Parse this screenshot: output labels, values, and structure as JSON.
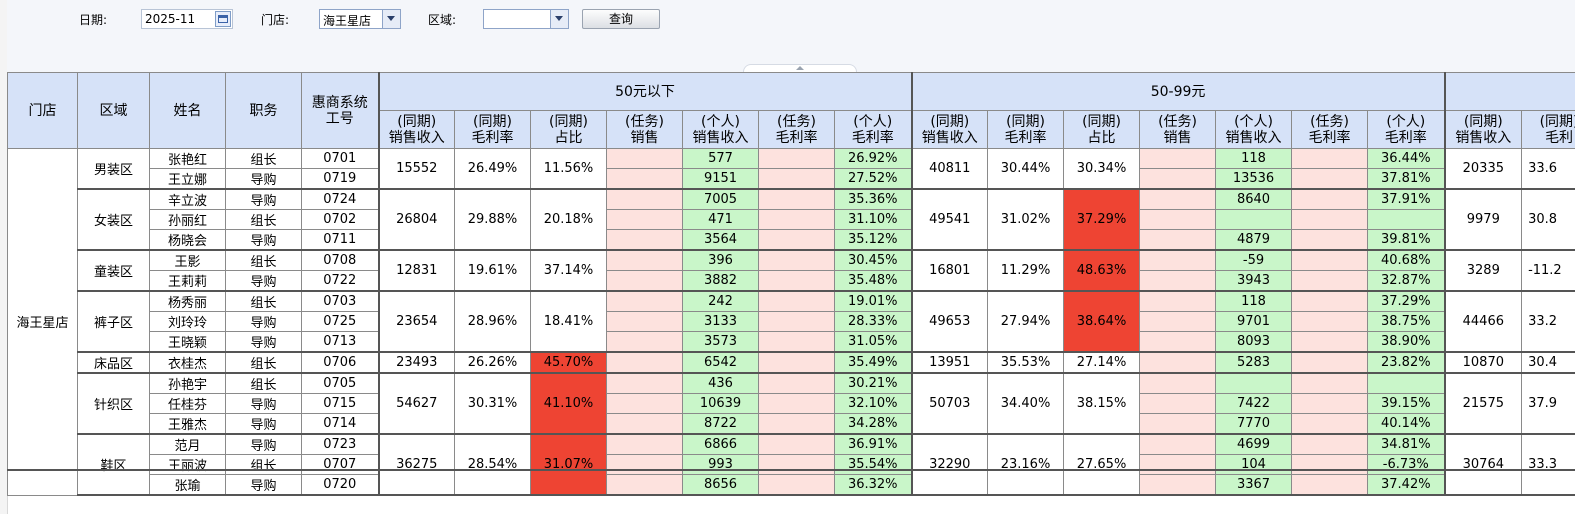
{
  "toolbar": {
    "date_label": "日期:",
    "date_value": "2025-11",
    "store_label": "门店:",
    "store_value": "海王星店",
    "region_label": "区域:",
    "region_value": "",
    "query_button": "查询"
  },
  "header": {
    "store": "门店",
    "region": "区域",
    "name": "姓名",
    "position": "职务",
    "employee_id_l1": "惠商系统",
    "employee_id_l2": "工号",
    "group1": "50元以下",
    "group2": "50-99元",
    "sub": [
      [
        "(同期)",
        "销售收入"
      ],
      [
        "(同期)",
        "毛利率"
      ],
      [
        "(同期)",
        "占比"
      ],
      [
        "(任务)",
        "销售"
      ],
      [
        "(个人)",
        "销售收入"
      ],
      [
        "(任务)",
        "毛利率"
      ],
      [
        "(个人)",
        "毛利率"
      ]
    ],
    "extra": [
      [
        "(同期)",
        "销售收入"
      ],
      [
        "(同期)",
        "毛利"
      ]
    ]
  },
  "store_name": "海王星店",
  "groups": [
    {
      "region": "男装区",
      "g1": {
        "rev": "15552",
        "margin": "26.49%",
        "share": "11.56%"
      },
      "g2": {
        "rev": "40811",
        "margin": "30.44%",
        "share": "30.34%"
      },
      "g3": {
        "rev": "20335",
        "margin": "33.6"
      }
    },
    {
      "region": "女装区",
      "g1": {
        "rev": "26804",
        "margin": "29.88%",
        "share": "20.18%"
      },
      "g2": {
        "rev": "49541",
        "margin": "31.02%",
        "share": "37.29%"
      },
      "g3": {
        "rev": "9979",
        "margin": "30.8"
      }
    },
    {
      "region": "童装区",
      "g1": {
        "rev": "12831",
        "margin": "19.61%",
        "share": "37.14%"
      },
      "g2": {
        "rev": "16801",
        "margin": "11.29%",
        "share": "48.63%"
      },
      "g3": {
        "rev": "3289",
        "margin": "-11.2"
      }
    },
    {
      "region": "裤子区",
      "g1": {
        "rev": "23654",
        "margin": "28.96%",
        "share": "18.41%"
      },
      "g2": {
        "rev": "49653",
        "margin": "27.94%",
        "share": "38.64%"
      },
      "g3": {
        "rev": "44466",
        "margin": "33.2"
      }
    },
    {
      "region": "床品区",
      "g1": {
        "rev": "23493",
        "margin": "26.26%",
        "share": "45.70%"
      },
      "g2": {
        "rev": "13951",
        "margin": "35.53%",
        "share": "27.14%"
      },
      "g3": {
        "rev": "10870",
        "margin": "30.4"
      }
    },
    {
      "region": "针织区",
      "g1": {
        "rev": "54627",
        "margin": "30.31%",
        "share": "41.10%"
      },
      "g2": {
        "rev": "50703",
        "margin": "34.40%",
        "share": "38.15%"
      },
      "g3": {
        "rev": "21575",
        "margin": "37.9"
      }
    },
    {
      "region": "鞋区",
      "g1": {
        "rev": "36275",
        "margin": "28.54%",
        "share": "31.07%"
      },
      "g2": {
        "rev": "32290",
        "margin": "23.16%",
        "share": "27.65%"
      },
      "g3": {
        "rev": "30764",
        "margin": "33.3"
      }
    }
  ],
  "people": [
    {
      "name": "张艳红",
      "role": "组长",
      "id": "0701",
      "p1": "577",
      "pm1": "26.92%",
      "p2": "118",
      "pm2": "36.44%"
    },
    {
      "name": "王立娜",
      "role": "导购",
      "id": "0719",
      "p1": "9151",
      "pm1": "27.52%",
      "p2": "13536",
      "pm2": "37.81%"
    },
    {
      "name": "辛立波",
      "role": "导购",
      "id": "0724",
      "p1": "7005",
      "pm1": "35.36%",
      "p2": "8640",
      "pm2": "37.91%"
    },
    {
      "name": "孙丽红",
      "role": "组长",
      "id": "0702",
      "p1": "471",
      "pm1": "31.10%",
      "p2": "",
      "pm2": ""
    },
    {
      "name": "杨晓会",
      "role": "导购",
      "id": "0711",
      "p1": "3564",
      "pm1": "35.12%",
      "p2": "4879",
      "pm2": "39.81%"
    },
    {
      "name": "王影",
      "role": "组长",
      "id": "0708",
      "p1": "396",
      "pm1": "30.45%",
      "p2": "-59",
      "pm2": "40.68%"
    },
    {
      "name": "王莉莉",
      "role": "导购",
      "id": "0722",
      "p1": "3882",
      "pm1": "35.48%",
      "p2": "3943",
      "pm2": "32.87%"
    },
    {
      "name": "杨秀丽",
      "role": "组长",
      "id": "0703",
      "p1": "242",
      "pm1": "19.01%",
      "p2": "118",
      "pm2": "37.29%"
    },
    {
      "name": "刘玲玲",
      "role": "导购",
      "id": "0725",
      "p1": "3133",
      "pm1": "28.33%",
      "p2": "9701",
      "pm2": "38.75%"
    },
    {
      "name": "王晓颖",
      "role": "导购",
      "id": "0713",
      "p1": "3573",
      "pm1": "31.05%",
      "p2": "8093",
      "pm2": "38.90%"
    },
    {
      "name": "衣桂杰",
      "role": "组长",
      "id": "0706",
      "p1": "6542",
      "pm1": "35.49%",
      "p2": "5283",
      "pm2": "23.82%"
    },
    {
      "name": "孙艳宇",
      "role": "组长",
      "id": "0705",
      "p1": "436",
      "pm1": "30.21%",
      "p2": "",
      "pm2": ""
    },
    {
      "name": "任桂芬",
      "role": "导购",
      "id": "0715",
      "p1": "10639",
      "pm1": "32.10%",
      "p2": "7422",
      "pm2": "39.15%"
    },
    {
      "name": "王雅杰",
      "role": "导购",
      "id": "0714",
      "p1": "8722",
      "pm1": "34.28%",
      "p2": "7770",
      "pm2": "40.14%"
    },
    {
      "name": "范月",
      "role": "导购",
      "id": "0723",
      "p1": "6866",
      "pm1": "36.91%",
      "p2": "4699",
      "pm2": "34.81%"
    },
    {
      "name": "王丽波",
      "role": "组长",
      "id": "0707",
      "p1": "993",
      "pm1": "35.54%",
      "p2": "104",
      "pm2": "-6.73%"
    },
    {
      "name": "张瑜",
      "role": "导购",
      "id": "0720",
      "p1": "8656",
      "pm1": "36.32%",
      "p2": "3367",
      "pm2": "37.42%"
    }
  ],
  "colors": {
    "header_bg": "#d6e2f8",
    "task_bg": "#fde2de",
    "personal_bg": "#c9f6c9",
    "alert_red": "#ee4433"
  }
}
